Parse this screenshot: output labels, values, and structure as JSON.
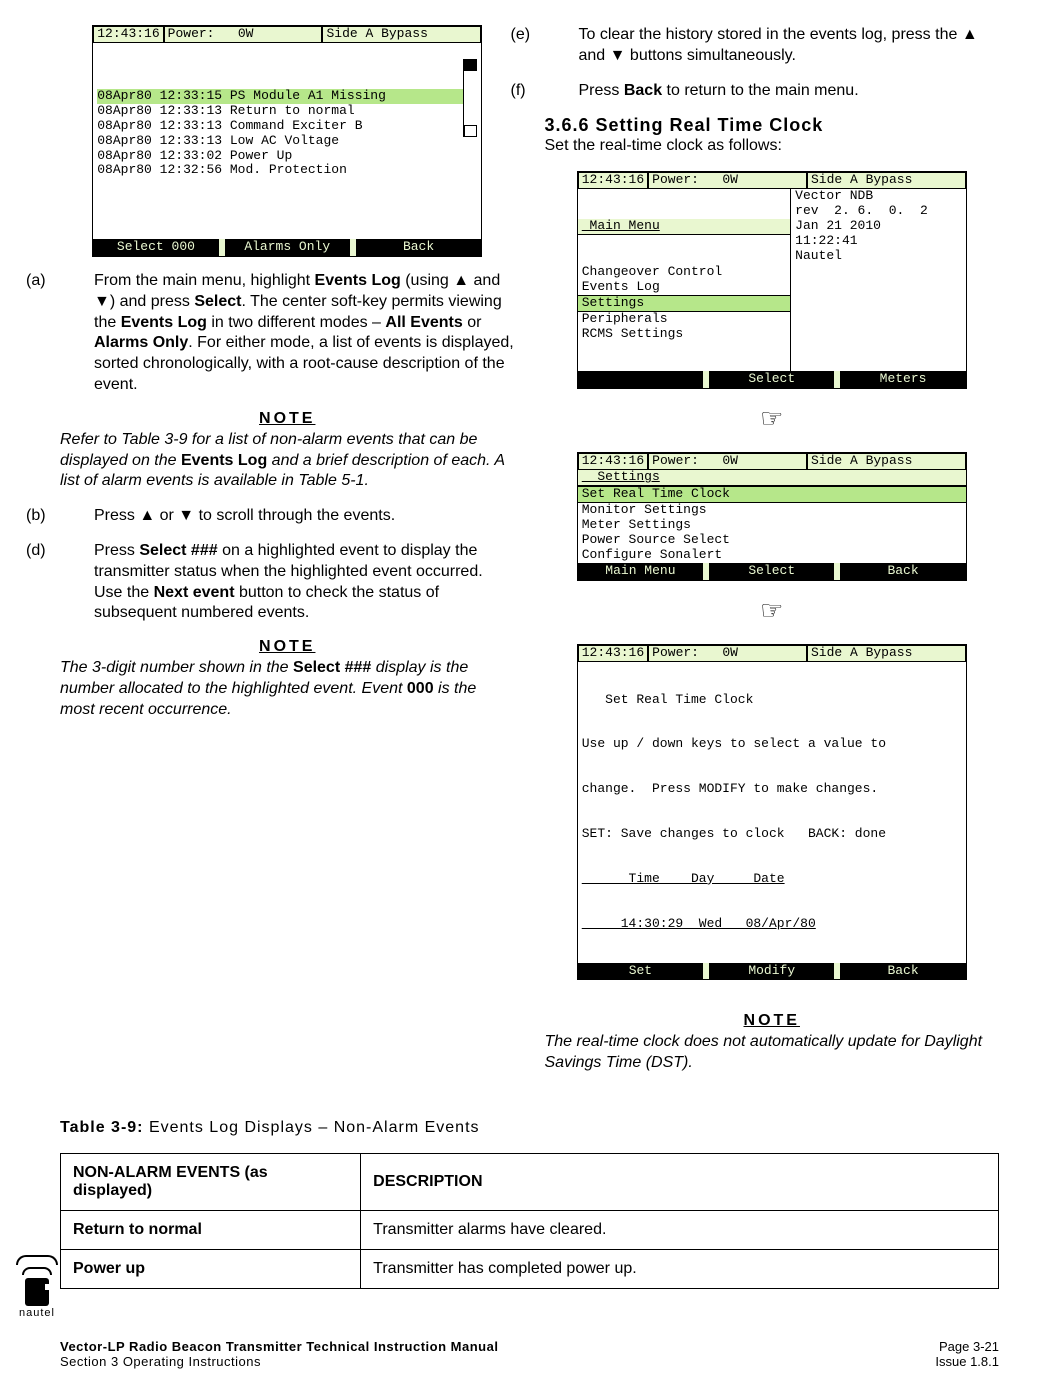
{
  "lcd1": {
    "hdr_time": "12:43:16",
    "hdr_power": "Power:   0W",
    "hdr_side": "Side A Bypass",
    "lines": [
      {
        "t": "08Apr80 12:33:15 PS Module A1 Missing",
        "hi": true
      },
      {
        "t": "08Apr80 12:33:13 Return to normal",
        "hi": false
      },
      {
        "t": "08Apr80 12:33:13 Command Exciter B",
        "hi": false
      },
      {
        "t": "08Apr80 12:33:13 Low AC Voltage",
        "hi": false
      },
      {
        "t": "08Apr80 12:33:02 Power Up",
        "hi": false
      },
      {
        "t": "08Apr80 12:32:56 Mod. Protection",
        "hi": false
      }
    ],
    "btn1": "Select 000",
    "btn2": "Alarms Only",
    "btn3": "Back"
  },
  "left": {
    "a_tag": "(a)",
    "a_text_1": "From the main menu, highlight ",
    "a_text_bold1": "Events Log",
    "a_text_2": " (using ▲ and ▼) and press ",
    "a_text_bold2": "Select",
    "a_text_3": ". The center soft-key permits viewing the ",
    "a_text_bold3": "Events Log",
    "a_text_4": " in two different modes – ",
    "a_text_bold4": "All Events",
    "a_text_5": " or ",
    "a_text_bold5": "Alarms Only",
    "a_text_6": ". For either mode, a list of events is displayed, sorted chronologically, with a root-cause description of the event.",
    "note1_head": "NOTE",
    "note1_a": "Refer to Table 3-9 for a list of non-alarm events that can be displayed on the ",
    "note1_bold": "Events Log",
    "note1_b": " and a brief description of each. A list of alarm events is available in Table 5-1.",
    "b_tag": "(b)",
    "b_text": "Press ▲ or ▼ to scroll through the events.",
    "d_tag": "(d)",
    "d_text_1": "Press ",
    "d_bold1": "Select ###",
    "d_text_2": " on a highlighted event to display the transmitter status when the highlighted event occurred. Use the ",
    "d_bold2": "Next event",
    "d_text_3": " button to check the status of subsequent numbered events.",
    "note2_head": "NOTE",
    "note2_a": "The 3-digit number shown in the ",
    "note2_bold1": "Select ###",
    "note2_b": " display is the number allocated to the highlighted event. Event ",
    "note2_bold2": "000",
    "note2_c": " is the most recent occurrence."
  },
  "right": {
    "e_tag": "(e)",
    "e_text": "To clear the history stored in the events log, press the ▲ and ▼ buttons simultaneously.",
    "f_tag": "(f)",
    "f_text_1": "Press ",
    "f_bold": "Back",
    "f_text_2": " to return to the main menu.",
    "sec_num": "3.6.6 Setting Real Time Clock",
    "sec_intro": "Set the real-time clock as follows:",
    "note3_head": "NOTE",
    "note3": "The real-time clock does not automatically update for Daylight Savings Time (DST)."
  },
  "lcd2": {
    "hdr_time": "12:43:16",
    "hdr_power": "Power:   0W",
    "hdr_side": "Side A Bypass",
    "title": " Main Menu",
    "left_items": [
      "Changeover Control",
      "Events Log",
      "Settings",
      "Peripherals",
      "RCMS Settings"
    ],
    "hl_index": 2,
    "right_lines": [
      "Vector NDB",
      "rev  2. 6.  0.  2",
      "Jan 21 2010",
      "11:22:41",
      "Nautel"
    ],
    "btn1": "",
    "btn2": "Select",
    "btn3": "Meters"
  },
  "lcd3": {
    "hdr_time": "12:43:16",
    "hdr_power": "Power:   0W",
    "hdr_side": "Side A Bypass",
    "title": "  Settings",
    "items": [
      "Set Real Time Clock",
      "Monitor Settings",
      "Meter Settings",
      "Power Source Select",
      "Configure Sonalert"
    ],
    "hl_index": 0,
    "btn1": "Main Menu",
    "btn2": "Select",
    "btn3": "Back"
  },
  "lcd4": {
    "hdr_time": "12:43:16",
    "hdr_power": "Power:   0W",
    "hdr_side": "Side A Bypass",
    "title": "   Set Real Time Clock",
    "line1": "Use up / down keys to select a value to",
    "line2": "change.  Press MODIFY to make changes.",
    "line3": "SET: Save changes to clock   BACK: done",
    "cols": "      Time    Day     Date",
    "vals": "     14:30:29  Wed   08/Apr/80",
    "btn1": "Set",
    "btn2": "Modify",
    "btn3": "Back"
  },
  "hand": "☞",
  "table": {
    "title_bold": "Table 3-9:",
    "title_rest": " Events Log Displays – Non-Alarm Events",
    "head1": "NON-ALARM EVENTS (as displayed)",
    "head2": "DESCRIPTION",
    "rows": [
      {
        "c1": "Return to normal",
        "c2": "Transmitter alarms have cleared."
      },
      {
        "c1": "Power up",
        "c2": "Transmitter has completed power up."
      }
    ]
  },
  "footer": {
    "l1": "Vector-LP Radio Beacon Transmitter Technical Instruction Manual",
    "l2": "Section 3 Operating Instructions",
    "r1": "Page 3-21",
    "r2": "Issue 1.8.1"
  },
  "logo_text": "nautel"
}
